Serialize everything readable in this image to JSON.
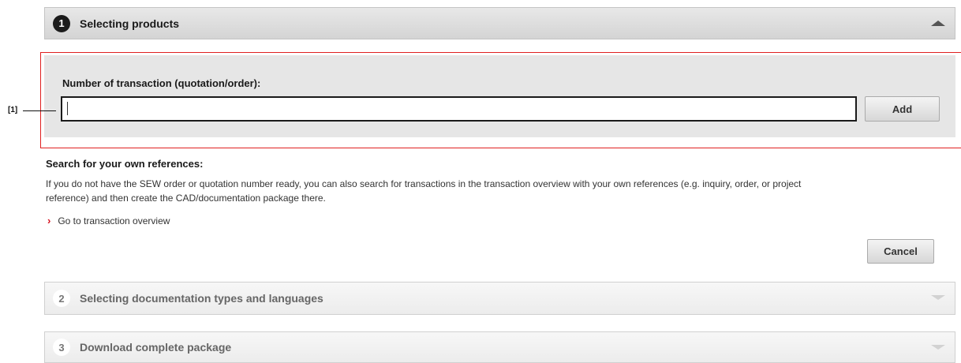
{
  "steps": [
    {
      "number": "1",
      "title": "Selecting products",
      "expanded": true
    },
    {
      "number": "2",
      "title": "Selecting documentation types and languages",
      "expanded": false
    },
    {
      "number": "3",
      "title": "Download complete package",
      "expanded": false
    }
  ],
  "transaction_form": {
    "label": "Number of transaction (quotation/order):",
    "value": "",
    "add_button": "Add"
  },
  "callout": "[1]",
  "search_references": {
    "heading": "Search for your own references:",
    "description_line1": "If you do not have the SEW order or quotation number ready, you can also search for transactions in the transaction overview with your own references (e.g. inquiry, order, or project",
    "description_line2": "reference) and then create the CAD/documentation package there.",
    "link": "Go to transaction overview"
  },
  "cancel_button": "Cancel",
  "icons": {
    "step1_toggle": "chevron-up-icon",
    "step_collapsed_toggle": "chevron-down-icon",
    "link_arrow": "chevron-right-icon"
  },
  "colors": {
    "highlight": "#e02020",
    "link_arrow": "#d7101e",
    "active_step_badge": "#1c1c1c"
  }
}
